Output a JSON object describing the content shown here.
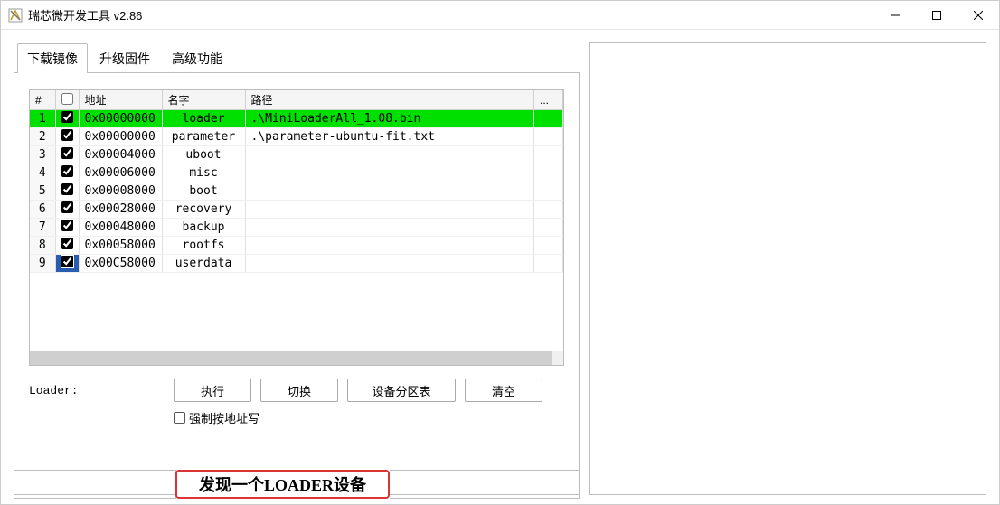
{
  "window": {
    "title": "瑞芯微开发工具 v2.86"
  },
  "tabs": {
    "download": "下载镜像",
    "upgrade": "升级固件",
    "advanced": "高级功能"
  },
  "table": {
    "headers": {
      "idx": "#",
      "chk": "☐",
      "addr": "地址",
      "name": "名字",
      "path": "路径",
      "dots": "..."
    },
    "rows": [
      {
        "idx": "1",
        "checked": true,
        "addr": "0x00000000",
        "name": "loader",
        "path": ".\\MiniLoaderAll_1.08.bin",
        "highlight": true
      },
      {
        "idx": "2",
        "checked": true,
        "addr": "0x00000000",
        "name": "parameter",
        "path": ".\\parameter-ubuntu-fit.txt"
      },
      {
        "idx": "3",
        "checked": true,
        "addr": "0x00004000",
        "name": "uboot",
        "path": ""
      },
      {
        "idx": "4",
        "checked": true,
        "addr": "0x00006000",
        "name": "misc",
        "path": ""
      },
      {
        "idx": "5",
        "checked": true,
        "addr": "0x00008000",
        "name": "boot",
        "path": ""
      },
      {
        "idx": "6",
        "checked": true,
        "addr": "0x00028000",
        "name": "recovery",
        "path": ""
      },
      {
        "idx": "7",
        "checked": true,
        "addr": "0x00048000",
        "name": "backup",
        "path": ""
      },
      {
        "idx": "8",
        "checked": true,
        "addr": "0x00058000",
        "name": "rootfs",
        "path": ""
      },
      {
        "idx": "9",
        "checked": true,
        "addr": "0x00C58000",
        "name": "userdata",
        "path": "",
        "current": true
      }
    ]
  },
  "toolbar": {
    "loader_label": "Loader:",
    "execute": "执行",
    "switch": "切换",
    "partition_table": "设备分区表",
    "clear": "清空",
    "force_write": "强制按地址写"
  },
  "status": {
    "text": "发现一个LOADER设备"
  }
}
